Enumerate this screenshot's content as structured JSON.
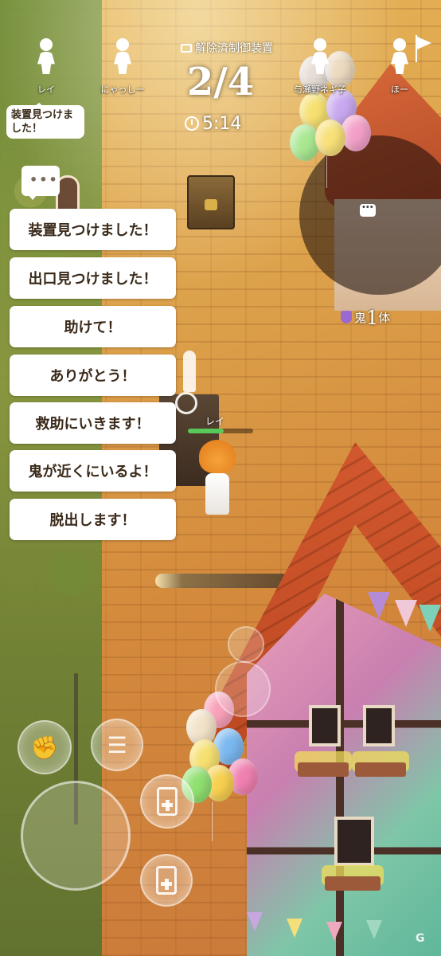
{
  "players": [
    {
      "name": "レイ"
    },
    {
      "name": "にゃっしー"
    },
    {
      "name": "与瀬野ネギ子"
    },
    {
      "name": "ほー"
    }
  ],
  "status_bubble": "装置見つけました！",
  "hud": {
    "device_label": "解除済制御装置",
    "progress": "2/4",
    "timer": "5:14",
    "enemy_label": "鬼",
    "enemy_count": "1",
    "enemy_unit": "体"
  },
  "chat": {
    "options": [
      "装置見つけました！",
      "出口見つけました！",
      "助けて！",
      "ありがとう！",
      "救助にいきます！",
      "鬼が近くにいるよ！",
      "脱出します！"
    ]
  },
  "character": {
    "name": "レイ",
    "hp_fraction": 0.55
  },
  "controls": {
    "joystick": "joystick",
    "skill_icon": "fist-icon",
    "ladder_icon": "ladder-icon",
    "item_icon": "health-card-icon"
  },
  "watermark": "G"
}
